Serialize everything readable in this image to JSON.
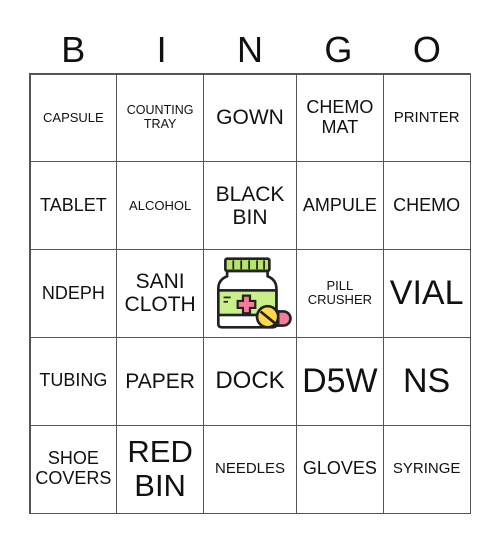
{
  "header": {
    "letters": [
      "B",
      "I",
      "N",
      "G",
      "O"
    ]
  },
  "cells": [
    [
      "CAPSULE",
      "COUNTING\nTRAY",
      "GOWN",
      "CHEMO\nMAT",
      "PRINTER"
    ],
    [
      "TABLET",
      "ALCOHOL",
      "BLACK\nBIN",
      "AMPULE",
      "CHEMO"
    ],
    [
      "NDEPH",
      "SANI\nCLOTH",
      "",
      "PILL\nCRUSHER",
      "VIAL"
    ],
    [
      "TUBING",
      "PAPER",
      "DOCK",
      "D5W",
      "NS"
    ],
    [
      "SHOE\nCOVERS",
      "RED\nBIN",
      "NEEDLES",
      "GLOVES",
      "SYRINGE"
    ]
  ],
  "free_space": {
    "icon": "medicine-bottle-pill-icon",
    "colors": {
      "cap": "#b6e36b",
      "label": "#c9f08a",
      "cross": "#f47c9a",
      "pill_yellow": "#ffd84a",
      "pill_pink": "#f47c9a"
    }
  }
}
